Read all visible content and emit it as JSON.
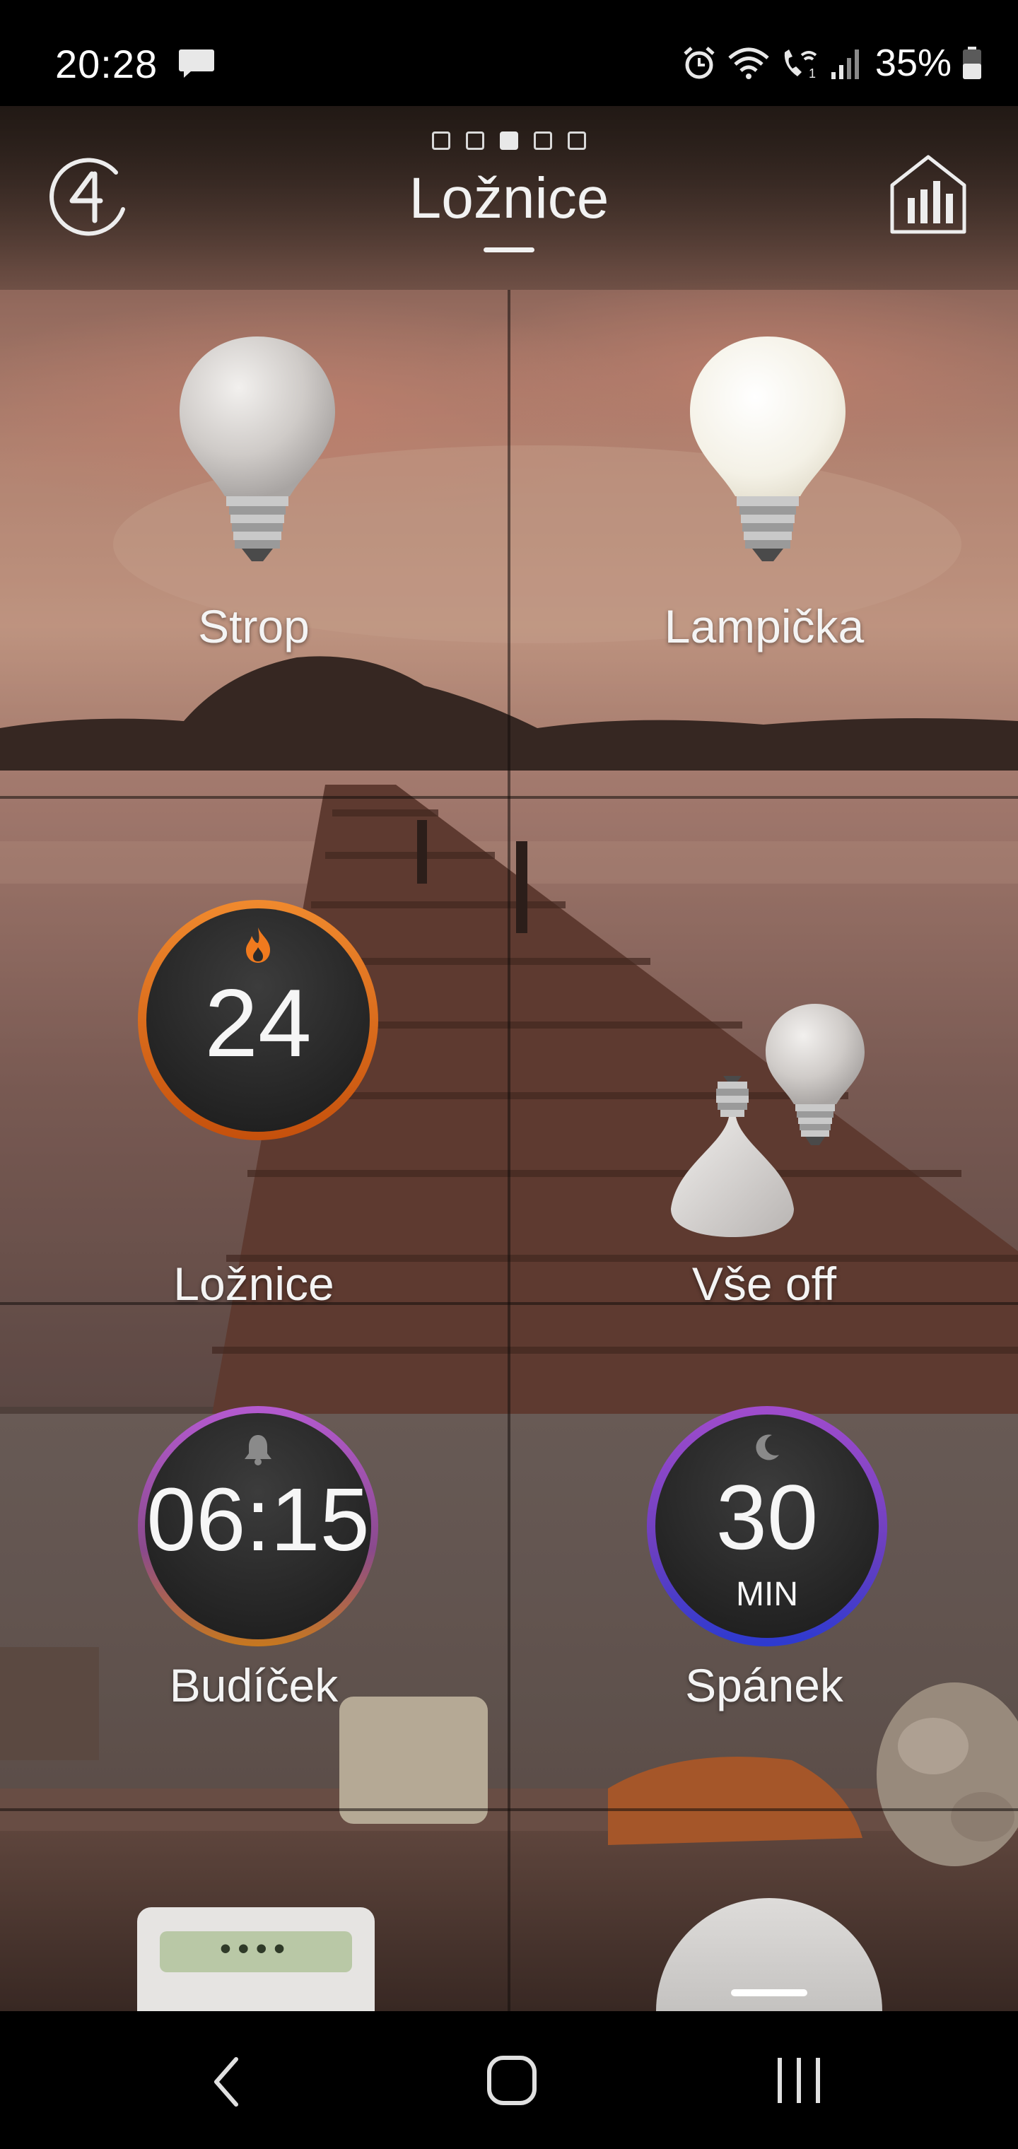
{
  "status_bar": {
    "time": "20:28",
    "battery_percent": "35%",
    "icons": [
      "message-icon",
      "alarm-icon",
      "wifi-icon",
      "wifi-call-icon",
      "signal-icon",
      "battery-icon"
    ]
  },
  "header": {
    "title": "Ložnice",
    "page_count": 5,
    "active_page": 3,
    "logo_icon": "loxone-logo-icon",
    "stats_icon": "statistics-icon"
  },
  "tiles": [
    {
      "id": "strop",
      "label": "Strop",
      "type": "light",
      "state": "off"
    },
    {
      "id": "lampicka",
      "label": "Lampička",
      "type": "light",
      "state": "on"
    },
    {
      "id": "loznice",
      "label": "Ložnice",
      "type": "thermostat",
      "value": "24",
      "icon": "flame-icon",
      "accent": "#e06a14"
    },
    {
      "id": "vse-off",
      "label": "Vše off",
      "type": "lighting-scene"
    },
    {
      "id": "budicek",
      "label": "Budíček",
      "type": "alarm-clock",
      "value": "06:15",
      "icon": "bell-icon",
      "accent": "#a04fb8"
    },
    {
      "id": "spanek",
      "label": "Spánek",
      "type": "sleep-timer",
      "value": "30",
      "unit": "MIN",
      "icon": "moon-icon",
      "accent": "#6a3fc0"
    },
    {
      "id": "device-left",
      "label": "",
      "type": "device",
      "display": "••••"
    },
    {
      "id": "device-right",
      "label": "",
      "type": "device"
    }
  ],
  "navbar": {
    "back": "back-icon",
    "home": "home-icon",
    "recents": "recents-icon"
  }
}
